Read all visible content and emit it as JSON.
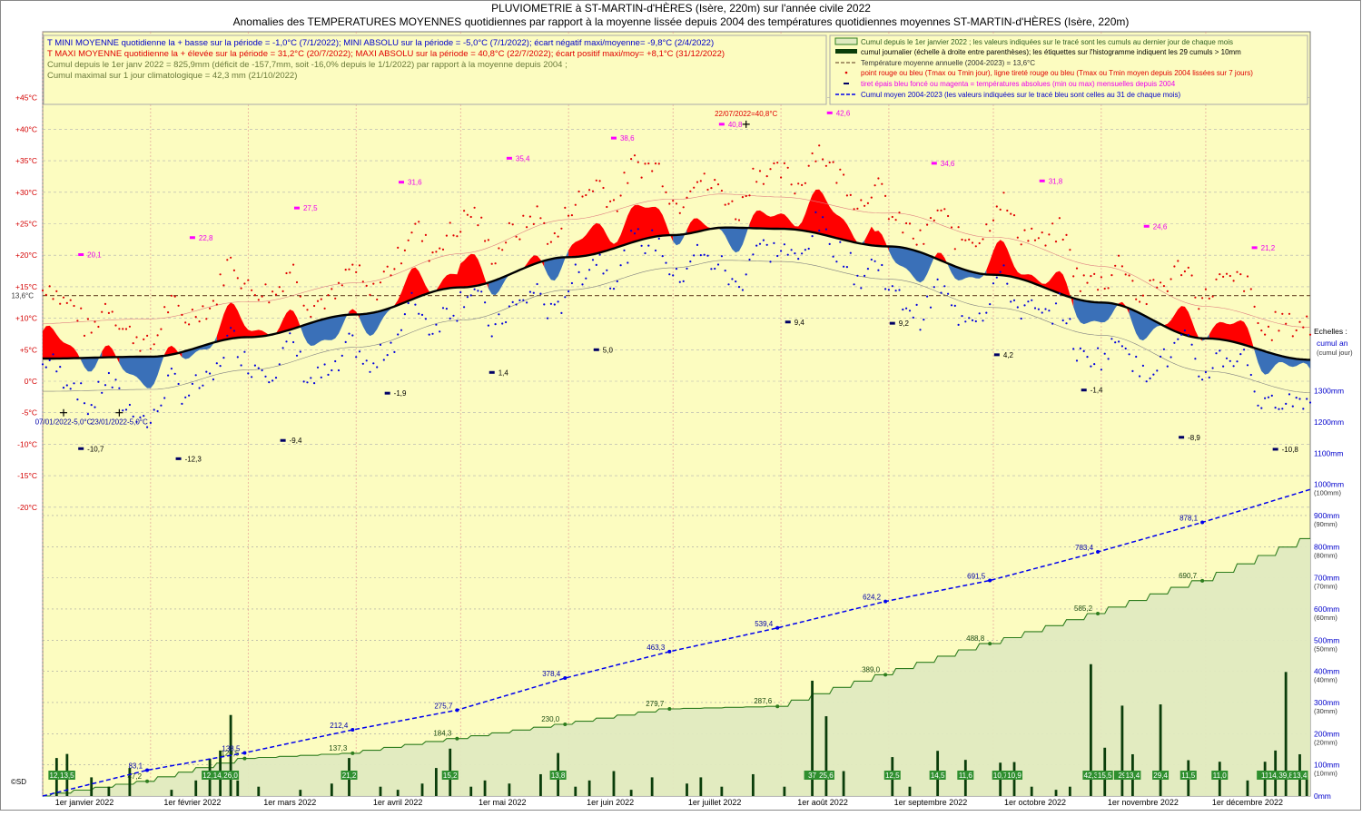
{
  "titles": {
    "line1": "PLUVIOMETRIE à ST-MARTIN-d'HÈRES (Isère, 220m) sur l'année civile 2022",
    "line2": "Anomalies des TEMPERATURES MOYENNES quotidiennes par rapport à la moyenne lissée depuis 2004 des températures quotidiennes moyennes ST-MARTIN-d'HÈRES (Isère, 220m)"
  },
  "info_box": {
    "line1": "T MINI MOYENNE quotidienne la + basse sur la période = -1,0°C (7/1/2022); MINI ABSOLU sur la période = -5,0°C (7/1/2022); écart négatif maxi/moyenne= -9,8°C (2/4/2022)",
    "line2": "T MAXI MOYENNE quotidienne la + élevée sur la période = 31,2°C (20/7/2022); MAXI ABSOLU sur la période = 40,8°C (22/7/2022); écart positif maxi/moy= +8,1°C (31/12/2022)",
    "line3": "Cumul depuis le 1er janv 2022 = 825,9mm (déficit de -157,7mm, soit -16,0% depuis le 1/1/2022) par rapport à la moyenne depuis 2004 ;",
    "line4": "Cumul maximal sur 1 jour climatologique = 42,3 mm (21/10/2022)"
  },
  "legend": {
    "items": [
      "Cumul depuis le 1er janvier 2022 ; les valeurs indiquées sur le tracé sont les cumuls au dernier jour de chaque mois",
      "cumul journalier (échelle à droite entre parenthèses); les étiquettes sur l'histogramme indiquent les 29 cumuls > 10mm",
      "Température moyenne annuelle (2004-2023) = 13,6°C",
      "point rouge ou bleu (Tmax ou Tmin jour), ligne tireté rouge ou bleu (Tmax ou Tmin moyen depuis 2004 lissées sur 7 jours)",
      "tiret épais bleu foncé ou magenta = températures absolues (min ou max) mensuelles depuis 2004",
      "Cumul moyen 2004-2023 (les valeurs indiquées sur le tracé bleu sont celles au 31 de chaque mois)"
    ]
  },
  "colors": {
    "plot_bg": "#fcfcc0",
    "cumul_fill": "#e0eac0",
    "cumul_line": "#2e7d1e",
    "bars": "#0a3d0a",
    "mean_line": "#000000",
    "anom_pos": "#ff0000",
    "anom_neg": "#3a70b8",
    "tmax_dot": "#e00000",
    "tmin_dot": "#0000dd",
    "abs_max": "#ff00ff",
    "abs_min": "#000066",
    "avg_cumul": "#0000ee",
    "annual_mean": "#7a5c3a"
  },
  "chart_data": {
    "type": "line",
    "x_axis": {
      "range": [
        1,
        365
      ],
      "labels": [
        "1er janvier 2022",
        "1er février 2022",
        "1er mars 2022",
        "1er avril 2022",
        "1er mai 2022",
        "1er juin 2022",
        "1er juillet 2022",
        "1er août 2022",
        "1er septembre 2022",
        "1er octobre 2022",
        "1er novembre 2022",
        "1er décembre 2022"
      ],
      "label_days": [
        1,
        32,
        60,
        91,
        121,
        152,
        182,
        213,
        244,
        274,
        305,
        335
      ]
    },
    "y_left": {
      "label": "temperature",
      "range": [
        -30,
        45
      ],
      "ticks": [
        -20,
        -15,
        -10,
        -5,
        0,
        5,
        10,
        15,
        20,
        25,
        30,
        35,
        40,
        45
      ],
      "tick_labels": [
        "-20°C",
        "-15°C",
        "-10°C",
        "-5°C",
        "0°C",
        "+5°C",
        "+10°C",
        "+15°C",
        "+20°C",
        "+25°C",
        "+30°C",
        "+35°C",
        "+40°C",
        "+45°C"
      ]
    },
    "y_right": {
      "range": [
        0,
        2200
      ],
      "ticks": [
        0,
        100,
        200,
        300,
        400,
        500,
        600,
        700,
        800,
        900,
        1000,
        1100,
        1200,
        1300
      ],
      "tick_labels": [
        "0mm",
        "100mm",
        "200mm",
        "300mm",
        "400mm",
        "500mm",
        "600mm",
        "700mm",
        "800mm",
        "900mm",
        "1000mm",
        "1100mm",
        "1200mm",
        "1300mm"
      ],
      "sub_labels": [
        "",
        "(10mm)",
        "(20mm)",
        "(30mm)",
        "(40mm)",
        "(50mm)",
        "(60mm)",
        "(70mm)",
        "(80mm)",
        "(90mm)",
        "(100mm)",
        "",
        "",
        ""
      ],
      "caption1": "Echelles :",
      "caption2": "cumul an",
      "caption3": "(cumul jour)"
    },
    "annual_mean": {
      "value": 13.6,
      "label": "13,6°C"
    },
    "smoothed_mean_knots": [
      [
        1,
        3.6
      ],
      [
        32,
        3.9
      ],
      [
        60,
        7.0
      ],
      [
        91,
        10.6
      ],
      [
        121,
        14.9
      ],
      [
        152,
        19.7
      ],
      [
        182,
        23.2
      ],
      [
        197,
        24.4
      ],
      [
        213,
        24.2
      ],
      [
        244,
        21.4
      ],
      [
        274,
        16.9
      ],
      [
        305,
        12.5
      ],
      [
        335,
        6.8
      ],
      [
        365,
        3.4
      ]
    ],
    "monthly_cumul_end": [
      [
        31,
        47.2
      ],
      [
        59,
        120.5
      ],
      [
        90,
        137.3
      ],
      [
        120,
        184.3
      ],
      [
        151,
        230.0
      ],
      [
        181,
        279.7
      ],
      [
        212,
        287.6
      ],
      [
        243,
        389.0
      ],
      [
        273,
        488.8
      ],
      [
        304,
        585.2
      ],
      [
        334,
        690.7
      ],
      [
        365,
        825.9
      ]
    ],
    "monthly_cumul_labels": [
      "47,2",
      "120,5",
      "137,3",
      "184,3",
      "230,0",
      "279,7",
      "287,6",
      "389,0",
      "488,8",
      "585,2",
      "690,7"
    ],
    "avg_cumul_end": [
      [
        1,
        0
      ],
      [
        31,
        83.1
      ],
      [
        59,
        138.5
      ],
      [
        90,
        212.4
      ],
      [
        120,
        275.7
      ],
      [
        151,
        378.4
      ],
      [
        181,
        463.3
      ],
      [
        212,
        539.4
      ],
      [
        243,
        624.2
      ],
      [
        273,
        691.5
      ],
      [
        304,
        783.4
      ],
      [
        334,
        878.1
      ],
      [
        365,
        983.6
      ]
    ],
    "avg_cumul_labels": [
      "83,1",
      "138,5",
      "212,4",
      "275,7",
      "378,4",
      "463,3",
      "539,4",
      "624,2",
      "691,5",
      "783,4",
      "878,1"
    ],
    "rain_events": [
      [
        5,
        12.2
      ],
      [
        8,
        13.5
      ],
      [
        15,
        6
      ],
      [
        20,
        3
      ],
      [
        26,
        9
      ],
      [
        38,
        2
      ],
      [
        45,
        5
      ],
      [
        49,
        12.0
      ],
      [
        52,
        14.6
      ],
      [
        55,
        26.0
      ],
      [
        57,
        5
      ],
      [
        63,
        3
      ],
      [
        75,
        2
      ],
      [
        84,
        4
      ],
      [
        89,
        12.2
      ],
      [
        98,
        3
      ],
      [
        103,
        2
      ],
      [
        110,
        4
      ],
      [
        114,
        9
      ],
      [
        118,
        15.2
      ],
      [
        124,
        3
      ],
      [
        128,
        5
      ],
      [
        135,
        4
      ],
      [
        144,
        7
      ],
      [
        149,
        13.8
      ],
      [
        154,
        3
      ],
      [
        158,
        5
      ],
      [
        165,
        8
      ],
      [
        170,
        2
      ],
      [
        176,
        6
      ],
      [
        186,
        4
      ],
      [
        190,
        6
      ],
      [
        196,
        3
      ],
      [
        205,
        7
      ],
      [
        214,
        3
      ],
      [
        222,
        37.0
      ],
      [
        226,
        25.6
      ],
      [
        231,
        8
      ],
      [
        245,
        12.5
      ],
      [
        250,
        3
      ],
      [
        258,
        14.5
      ],
      [
        266,
        11.6
      ],
      [
        276,
        10.7
      ],
      [
        280,
        10.9
      ],
      [
        285,
        3
      ],
      [
        292,
        2
      ],
      [
        296,
        3
      ],
      [
        302,
        42.3
      ],
      [
        306,
        15.5
      ],
      [
        311,
        29.0
      ],
      [
        314,
        13.4
      ],
      [
        322,
        29.4
      ],
      [
        330,
        11.5
      ],
      [
        339,
        11.0
      ],
      [
        347,
        5
      ],
      [
        352,
        11.0
      ],
      [
        355,
        14.6
      ],
      [
        358,
        39.8
      ],
      [
        362,
        13.4
      ],
      [
        364,
        6
      ]
    ],
    "rain_labels": [
      "12,2",
      "13,5",
      "12,0",
      "14,6",
      "26,0",
      "21,2",
      "15,2",
      "13,8",
      "37",
      "25,6",
      "12,5",
      "14,5",
      "11,6",
      "10,7",
      "10,9",
      "42,3",
      "15,5",
      "29",
      "13,4",
      "29,4",
      "11,5",
      "11,0",
      "11",
      "14,6",
      "39,8",
      "13,4"
    ],
    "abs_max_marks": [
      [
        12,
        20.1,
        "20,1"
      ],
      [
        44,
        22.8,
        "22,8"
      ],
      [
        74,
        27.5,
        "27,5"
      ],
      [
        104,
        31.6,
        "31,6"
      ],
      [
        135,
        35.4,
        "35,4"
      ],
      [
        165,
        38.6,
        "38,6"
      ],
      [
        196,
        40.8,
        "40,8"
      ],
      [
        227,
        42.6,
        "42,6"
      ],
      [
        257,
        34.6,
        "34,6"
      ],
      [
        288,
        31.8,
        "31,8"
      ],
      [
        318,
        24.6,
        "24,6"
      ],
      [
        349,
        21.2,
        "21,2"
      ]
    ],
    "abs_min_marks": [
      [
        12,
        -10.7,
        "-10,7"
      ],
      [
        40,
        -12.3,
        "-12,3"
      ],
      [
        70,
        -9.4,
        "-9,4"
      ],
      [
        100,
        -1.9,
        "-1,9"
      ],
      [
        130,
        1.4,
        "1,4"
      ],
      [
        160,
        5.0,
        "5,0"
      ],
      [
        215,
        9.4,
        "9,4"
      ],
      [
        245,
        9.2,
        "9,2"
      ],
      [
        275,
        4.2,
        "4,2"
      ],
      [
        300,
        -1.4,
        "-1,4"
      ],
      [
        328,
        -8.9,
        "-8,9"
      ],
      [
        355,
        -10.8,
        "-10,8"
      ]
    ],
    "special_points": [
      {
        "day": 7,
        "value": -5.0,
        "label": "07/01/2022-5,0°C"
      },
      {
        "day": 23,
        "value": -5.0,
        "label": "23/01/2022-5,0°C"
      },
      {
        "day": 203,
        "value": 40.8,
        "label": "22/07/2022=40,8°C"
      }
    ],
    "copyright": "©SD"
  }
}
